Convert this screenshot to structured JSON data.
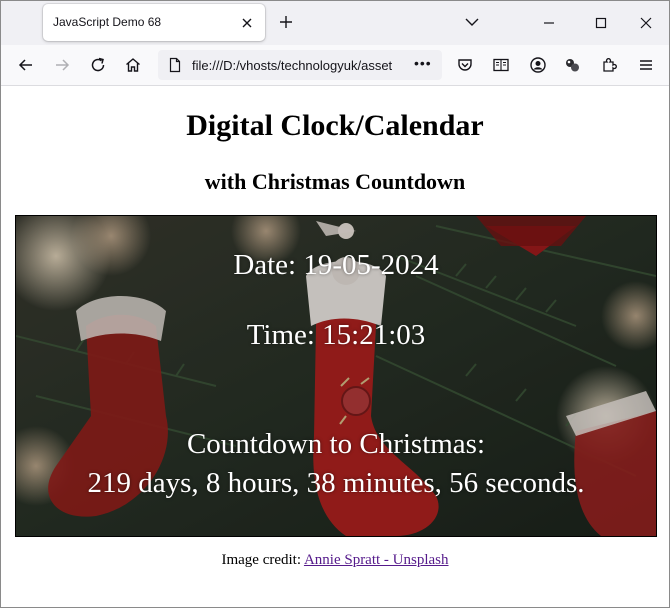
{
  "browser": {
    "tab_title": "JavaScript Demo 68",
    "url": "file:///D:/vhosts/technologyuk/asset",
    "url_more": "•••"
  },
  "icons": {
    "tab_close": "close-icon",
    "new_tab": "plus-icon",
    "list_tabs": "chevron-down-icon",
    "back": "back-arrow-icon",
    "forward": "forward-arrow-icon",
    "reload": "reload-icon",
    "home": "home-icon",
    "page": "page-icon",
    "pocket": "pocket-icon",
    "reader": "reader-view-icon",
    "account": "account-icon",
    "extension_dots": "extension-icon",
    "extensions": "puzzle-icon",
    "menu": "hamburger-menu-icon"
  },
  "page": {
    "title": "Digital Clock/Calendar",
    "subtitle": "with Christmas Countdown",
    "date_line": "Date: 19-05-2024",
    "time_line": "Time: 15:21:03",
    "countdown_label": "Countdown to Christmas:",
    "countdown_value": "219 days, 8 hours, 38 minutes, 56 seconds.",
    "credit_prefix": "Image credit: ",
    "credit_link": "Annie Spratt - Unsplash"
  },
  "colors": {
    "link": "#551a8b",
    "scene_text": "#ffffff"
  }
}
